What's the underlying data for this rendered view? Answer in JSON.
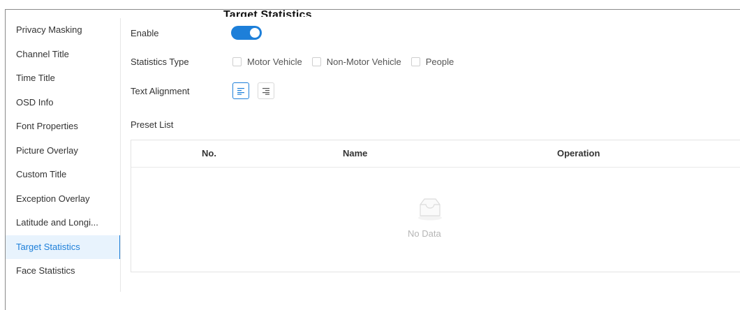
{
  "window": {
    "title": "Target Statistics"
  },
  "sidebar": {
    "items": [
      {
        "label": "Privacy Masking",
        "active": false
      },
      {
        "label": "Channel Title",
        "active": false
      },
      {
        "label": "Time Title",
        "active": false
      },
      {
        "label": "OSD Info",
        "active": false
      },
      {
        "label": "Font Properties",
        "active": false
      },
      {
        "label": "Picture Overlay",
        "active": false
      },
      {
        "label": "Custom Title",
        "active": false
      },
      {
        "label": "Exception Overlay",
        "active": false
      },
      {
        "label": "Latitude and Longi...",
        "active": false
      },
      {
        "label": "Target Statistics",
        "active": true
      },
      {
        "label": "Face Statistics",
        "active": false
      }
    ]
  },
  "form": {
    "enable": {
      "label": "Enable",
      "on": true
    },
    "statistics_type": {
      "label": "Statistics Type",
      "options": [
        {
          "label": "Motor Vehicle",
          "checked": false
        },
        {
          "label": "Non-Motor Vehicle",
          "checked": false
        },
        {
          "label": "People",
          "checked": false
        }
      ]
    },
    "text_alignment": {
      "label": "Text Alignment",
      "selected": "left",
      "options": [
        "left",
        "right"
      ]
    }
  },
  "preset": {
    "label": "Preset List",
    "columns": [
      "No.",
      "Name",
      "Operation"
    ],
    "rows": [],
    "empty_text": "No Data"
  },
  "colors": {
    "accent": "#1d7fd9",
    "active_bg": "#e8f3fd",
    "border": "#e3e3e3"
  },
  "icons": {
    "empty": "inbox-icon",
    "align_left": "align-left-icon",
    "align_right": "align-right-icon"
  }
}
